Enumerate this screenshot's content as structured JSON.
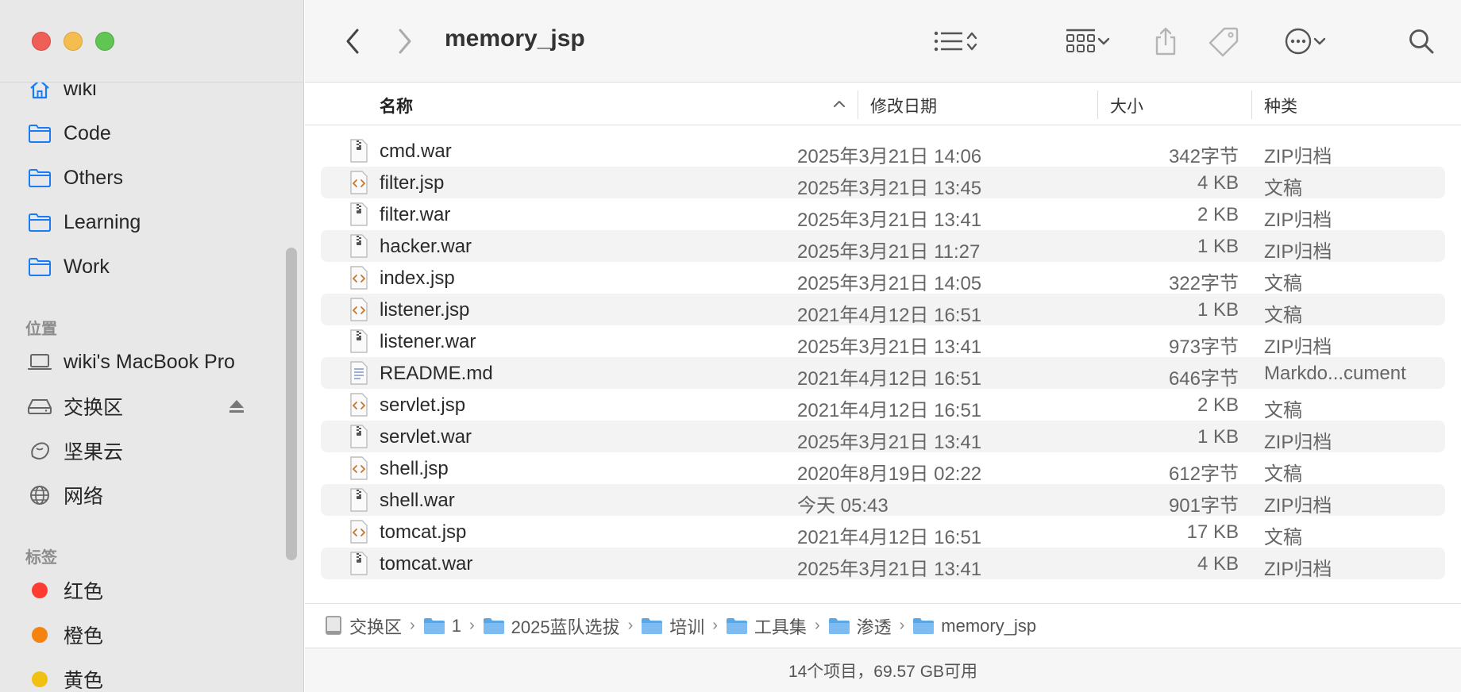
{
  "window": {
    "title": "memory_jsp"
  },
  "sidebar": {
    "favorites": [
      {
        "label": "wiki",
        "icon": "home-icon"
      },
      {
        "label": "Code",
        "icon": "folder-icon"
      },
      {
        "label": "Others",
        "icon": "folder-icon"
      },
      {
        "label": "Learning",
        "icon": "folder-icon"
      },
      {
        "label": "Work",
        "icon": "folder-icon"
      }
    ],
    "locations_header": "位置",
    "locations": [
      {
        "label": "wiki's MacBook Pro",
        "icon": "laptop-icon"
      },
      {
        "label": "交换区",
        "icon": "drive-icon"
      },
      {
        "label": "坚果云",
        "icon": "nutstore-icon"
      },
      {
        "label": "网络",
        "icon": "globe-icon"
      }
    ],
    "tags_header": "标签",
    "tags": [
      {
        "label": "红色",
        "color": "#fe3b30"
      },
      {
        "label": "橙色",
        "color": "#f5830f"
      },
      {
        "label": "黄色",
        "color": "#f2c012"
      }
    ]
  },
  "columns": {
    "name": "名称",
    "date": "修改日期",
    "size": "大小",
    "kind": "种类"
  },
  "files": [
    {
      "name": "cmd.war",
      "date": "2025年3月21日 14:06",
      "size": "342字节",
      "kind": "ZIP归档",
      "type": "zip"
    },
    {
      "name": "filter.jsp",
      "date": "2025年3月21日 13:45",
      "size": "4 KB",
      "kind": "文稿",
      "type": "code"
    },
    {
      "name": "filter.war",
      "date": "2025年3月21日 13:41",
      "size": "2 KB",
      "kind": "ZIP归档",
      "type": "zip"
    },
    {
      "name": "hacker.war",
      "date": "2025年3月21日 11:27",
      "size": "1 KB",
      "kind": "ZIP归档",
      "type": "zip"
    },
    {
      "name": "index.jsp",
      "date": "2025年3月21日 14:05",
      "size": "322字节",
      "kind": "文稿",
      "type": "code"
    },
    {
      "name": "listener.jsp",
      "date": "2021年4月12日 16:51",
      "size": "1 KB",
      "kind": "文稿",
      "type": "code"
    },
    {
      "name": "listener.war",
      "date": "2025年3月21日 13:41",
      "size": "973字节",
      "kind": "ZIP归档",
      "type": "zip"
    },
    {
      "name": "README.md",
      "date": "2021年4月12日 16:51",
      "size": "646字节",
      "kind": "Markdo...cument",
      "type": "doc"
    },
    {
      "name": "servlet.jsp",
      "date": "2021年4月12日 16:51",
      "size": "2 KB",
      "kind": "文稿",
      "type": "code"
    },
    {
      "name": "servlet.war",
      "date": "2025年3月21日 13:41",
      "size": "1 KB",
      "kind": "ZIP归档",
      "type": "zip"
    },
    {
      "name": "shell.jsp",
      "date": "2020年8月19日 02:22",
      "size": "612字节",
      "kind": "文稿",
      "type": "code"
    },
    {
      "name": "shell.war",
      "date": "今天 05:43",
      "size": "901字节",
      "kind": "ZIP归档",
      "type": "zip"
    },
    {
      "name": "tomcat.jsp",
      "date": "2021年4月12日 16:51",
      "size": "17 KB",
      "kind": "文稿",
      "type": "code"
    },
    {
      "name": "tomcat.war",
      "date": "2025年3月21日 13:41",
      "size": "4 KB",
      "kind": "ZIP归档",
      "type": "zip"
    }
  ],
  "pathbar": [
    {
      "label": "交换区",
      "icon": "drive-icon"
    },
    {
      "label": "1",
      "icon": "folder-icon"
    },
    {
      "label": "2025蓝队选拔",
      "icon": "folder-icon"
    },
    {
      "label": "培训",
      "icon": "folder-icon"
    },
    {
      "label": "工具集",
      "icon": "folder-icon"
    },
    {
      "label": "渗透",
      "icon": "folder-icon"
    },
    {
      "label": "memory_jsp",
      "icon": "folder-icon"
    }
  ],
  "status": {
    "text": "14个项目，69.57 GB可用"
  },
  "colors": {
    "accent": "#1a7cf5",
    "folder": "#5aa7e6",
    "jsp": "#c8782c"
  }
}
